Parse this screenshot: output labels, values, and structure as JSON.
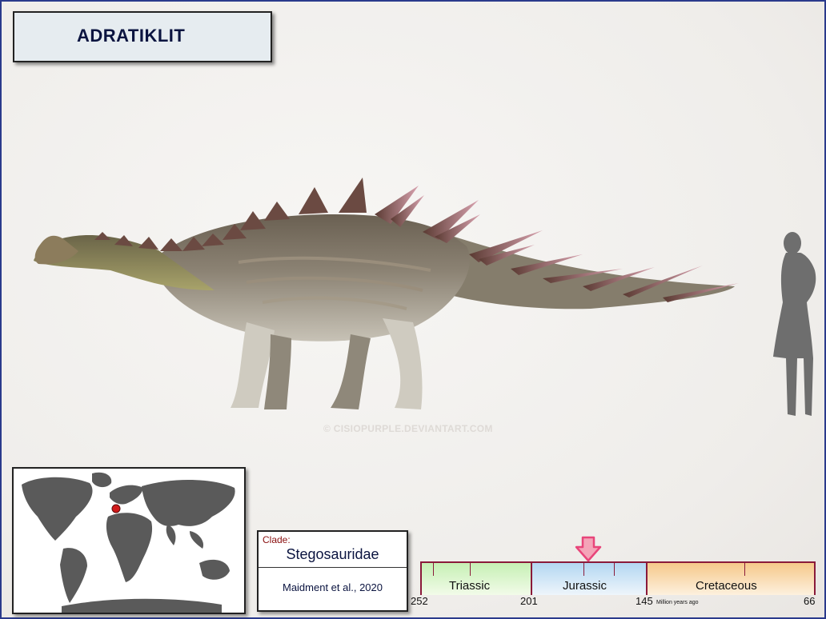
{
  "title": "ADRATIKLIT",
  "watermark": "© CISIOPURPLE.DEVIANTART.COM",
  "clade": {
    "label": "Clade:",
    "value": "Stegosauridae",
    "citation": "Maidment et al., 2020"
  },
  "timeline": {
    "periods": [
      "Triassic",
      "Jurassic",
      "Cretaceous"
    ],
    "ticks": [
      "252",
      "201",
      "145",
      "66"
    ],
    "unit_label": "Million years ago"
  },
  "colors": {
    "border": "#2a3a8c",
    "title_text": "#0b1440",
    "clade_label": "#8a0f0f",
    "marker": "#e8457a",
    "location_dot": "#d11a1a"
  },
  "icons": {
    "marker": "down-arrow-icon",
    "location": "location-dot-icon"
  }
}
